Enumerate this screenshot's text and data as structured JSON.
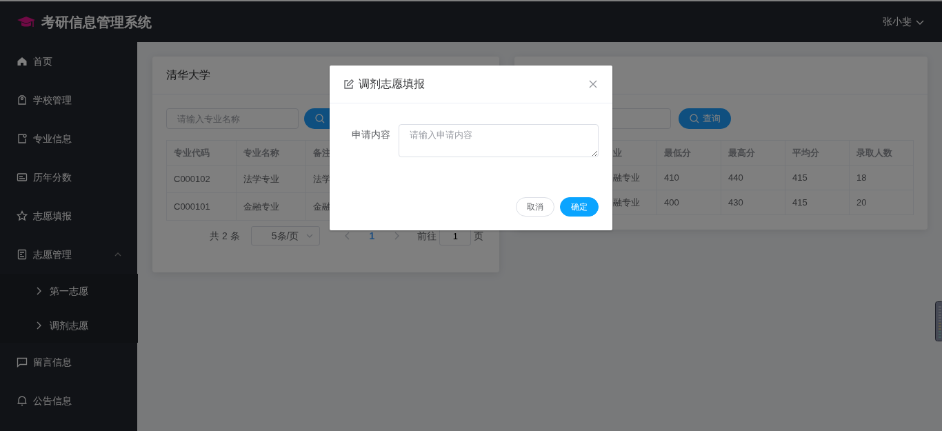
{
  "app": {
    "title": "考研信息管理系统",
    "user": "张小斐"
  },
  "sidebar": {
    "items": [
      {
        "label": "首页"
      },
      {
        "label": "学校管理"
      },
      {
        "label": "专业信息"
      },
      {
        "label": "历年分数"
      },
      {
        "label": "志愿填报"
      },
      {
        "label": "志愿管理",
        "expanded": true,
        "children": [
          {
            "label": "第一志愿"
          },
          {
            "label": "调剂志愿"
          }
        ]
      },
      {
        "label": "留言信息"
      },
      {
        "label": "公告信息"
      }
    ]
  },
  "left_card": {
    "title": "清华大学",
    "search": {
      "placeholder": "请输入专业名称"
    },
    "table": {
      "columns": [
        "专业代码",
        "专业名称",
        "备注"
      ],
      "rows": [
        [
          "C000102",
          "法学专业",
          "法学"
        ],
        [
          "C000101",
          "金融专业",
          "金融"
        ]
      ]
    },
    "pagination": {
      "total": "共 2 条",
      "page_size": "5条/页",
      "pages": [
        {
          "label": "1",
          "selected": true
        }
      ],
      "goto_label": "前往",
      "goto_value": "1",
      "page_suffix": "页"
    }
  },
  "right_card": {
    "search_button": "查询",
    "table": {
      "columns": [
        "业",
        "最低分",
        "最高分",
        "平均分",
        "录取人数"
      ],
      "rows": [
        [
          "融专业",
          "410",
          "440",
          "415",
          "18"
        ],
        [
          "融专业",
          "400",
          "430",
          "415",
          "20"
        ]
      ]
    }
  },
  "modal": {
    "title": "调剂志愿填报",
    "field_label": "申请内容",
    "placeholder": "请输入申请内容",
    "buttons": [
      {
        "label": "取消",
        "kind": "secondary"
      },
      {
        "label": "确定",
        "kind": "primary"
      }
    ]
  }
}
